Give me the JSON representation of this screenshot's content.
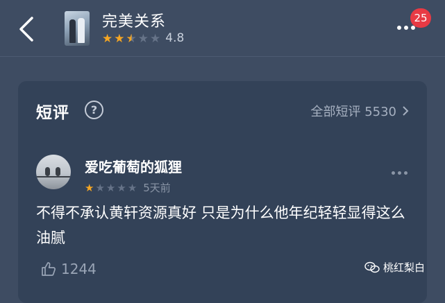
{
  "header": {
    "title": "完美关系",
    "rating": "4.8",
    "stars": [
      "full",
      "full",
      "half",
      "empty",
      "empty"
    ],
    "notification_count": "25"
  },
  "shortReviews": {
    "title": "短评",
    "help_glyph": "?",
    "all_link": "全部短评 5530",
    "review": {
      "username": "爱吃葡萄的狐狸",
      "stars": [
        "full",
        "empty",
        "empty",
        "empty",
        "empty"
      ],
      "time": "5天前",
      "text": "不得不承认黄轩资源真好 只是为什么他年纪轻轻显得这么油腻",
      "likes": "1244"
    }
  },
  "watermark": {
    "text": "桃红梨白"
  },
  "colors": {
    "background": "#3e4c62",
    "card": "#334258",
    "star": "#f5a623",
    "badge": "#e83a44"
  },
  "icons": [
    "back-arrow-icon",
    "more-icon",
    "help-icon",
    "chevron-right-icon",
    "thumbs-up-icon",
    "wechat-icon"
  ]
}
